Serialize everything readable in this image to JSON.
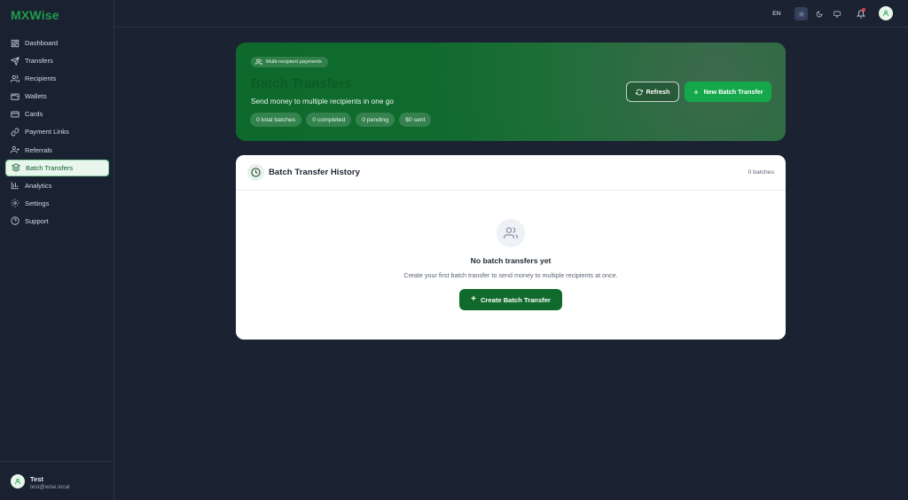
{
  "app": {
    "name": "MXWise"
  },
  "sidebar": {
    "items": [
      {
        "label": "Dashboard",
        "icon": "dashboard-grid-icon"
      },
      {
        "label": "Transfers",
        "icon": "send-icon"
      },
      {
        "label": "Recipients",
        "icon": "users-icon"
      },
      {
        "label": "Wallets",
        "icon": "wallet-icon"
      },
      {
        "label": "Cards",
        "icon": "credit-card-icon"
      },
      {
        "label": "Payment Links",
        "icon": "link-icon"
      },
      {
        "label": "Referrals",
        "icon": "user-plus-icon"
      },
      {
        "label": "Batch Transfers",
        "icon": "layers-icon",
        "active": true
      },
      {
        "label": "Analytics",
        "icon": "bar-chart-icon"
      },
      {
        "label": "Settings",
        "icon": "gear-icon"
      },
      {
        "label": "Support",
        "icon": "help-circle-icon"
      }
    ],
    "user": {
      "name": "Test",
      "email": "test@wise.local"
    }
  },
  "topbar": {
    "language": "EN"
  },
  "hero": {
    "chip": "Multi-recipient payments",
    "title": "Batch Transfers",
    "subtitle": "Send money to multiple recipients in one go",
    "stats": [
      "0 total batches",
      "0 completed",
      "0 pending",
      "$0 sent"
    ],
    "refresh_label": "Refresh",
    "new_label": "New Batch Transfer"
  },
  "history": {
    "title": "Batch Transfer History",
    "count": "0 batches",
    "empty_title": "No batch transfers yet",
    "empty_subtitle": "Create your first batch transfer to send money to multiple recipients at once.",
    "create_label": "Create Batch Transfer"
  },
  "colors": {
    "accent": "#1f9d49",
    "background": "#1b2333",
    "hero_green": "#106a2e",
    "primary_button": "#14a84a",
    "create_button": "#0f6a2c"
  }
}
